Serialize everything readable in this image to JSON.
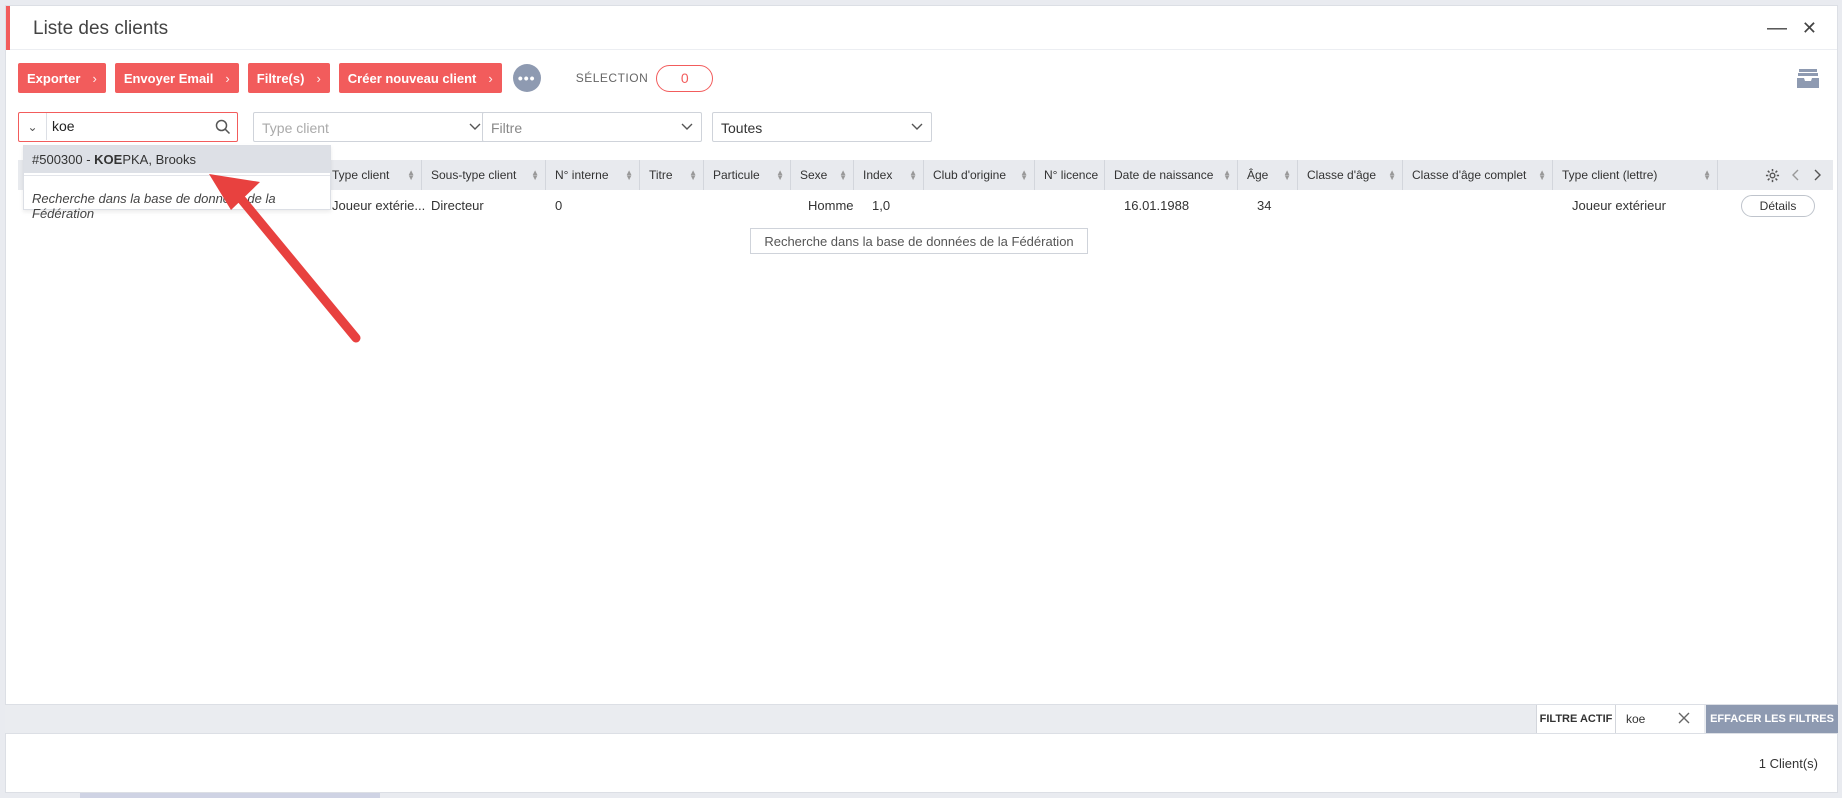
{
  "window": {
    "title": "Liste des clients",
    "minimize": "—",
    "close": "✕"
  },
  "toolbar": {
    "buttons": [
      "Exporter",
      "Envoyer Email",
      "Filtre(s)",
      "Créer nouveau client"
    ],
    "more": "•••",
    "selection_label": "SÉLECTION",
    "selection_count": "0"
  },
  "filters": {
    "search_value": "koe",
    "type_client_placeholder": "Type client",
    "filtre_placeholder": "Filtre",
    "toutes": "Toutes"
  },
  "autocomplete": {
    "prefix": "#500300 - ",
    "match": "KOE",
    "suffix": "PKA, Brooks",
    "federation_search": "Recherche dans la base de données de la Fédération"
  },
  "grid": {
    "columns": [
      "Type client",
      "Sous-type client",
      "N° interne",
      "Titre",
      "Particule",
      "Sexe",
      "Index",
      "Club d'origine",
      "N° licence",
      "Date de naissance",
      "Âge",
      "Classe d'âge",
      "Classe d'âge complet",
      "Type client (lettre)"
    ],
    "row": {
      "type_client": "Joueur extérie...",
      "sous_type": "Directeur",
      "n_interne": "0",
      "sexe": "Homme",
      "index": "1,0",
      "date_naissance": "16.01.1988",
      "age": "34",
      "type_lettre": "Joueur extérieur",
      "details": "Détails"
    },
    "federation_search": "Recherche dans la base de données de la Fédération"
  },
  "footer": {
    "active_filter_label": "FILTRE ACTIF",
    "active_filter_value": "koe",
    "clear_filters": "EFFACER LES FILTRES",
    "count": "1 Client(s)"
  },
  "colors": {
    "accent": "#f25c5c",
    "muted": "#8e9ab1"
  }
}
